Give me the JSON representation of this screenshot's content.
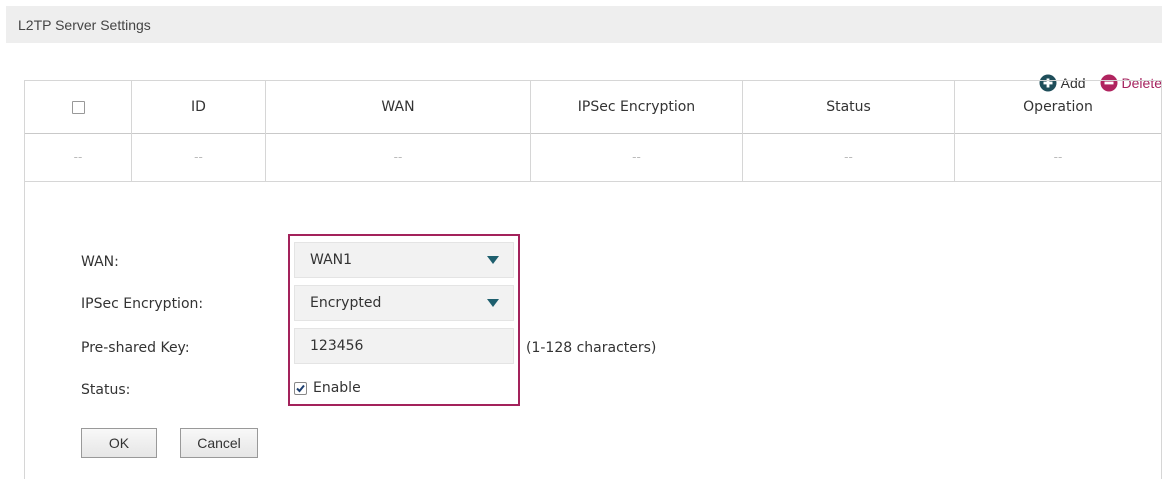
{
  "section": {
    "title": "L2TP Server Settings"
  },
  "toolbar": {
    "add_label": "Add",
    "delete_label": "Delete"
  },
  "colors": {
    "accent": "#a3225b",
    "add_icon": "#1f4e5a",
    "delete_icon": "#b0245f",
    "header_bg": "#eeeeee"
  },
  "table": {
    "columns": [
      "ID",
      "WAN",
      "IPSec Encryption",
      "Status",
      "Operation"
    ],
    "empty_row": [
      "--",
      "--",
      "--",
      "--",
      "--",
      "--"
    ]
  },
  "form": {
    "wan_label": "WAN:",
    "wan_value": "WAN1",
    "ipsec_label": "IPSec Encryption:",
    "ipsec_value": "Encrypted",
    "psk_label": "Pre-shared Key:",
    "psk_value": "123456",
    "psk_hint": "(1-128 characters)",
    "status_label": "Status:",
    "status_enable_label": "Enable",
    "status_enabled": true
  },
  "buttons": {
    "ok": "OK",
    "cancel": "Cancel"
  },
  "icons": {
    "add": "plus-circle-icon",
    "delete": "minus-circle-icon",
    "dropdown": "caret-down-icon",
    "checkbox": "checkbox-icon"
  }
}
